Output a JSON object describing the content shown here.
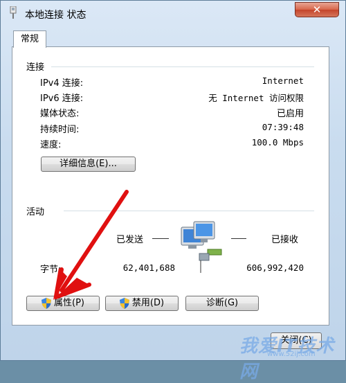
{
  "window": {
    "title": "本地连接 状态",
    "close_symbol": "✕"
  },
  "tabs": [
    {
      "label": "常规"
    }
  ],
  "connection": {
    "section_label": "连接",
    "rows": [
      {
        "label": "IPv4 连接:",
        "value": "Internet"
      },
      {
        "label": "IPv6 连接:",
        "value": "无 Internet 访问权限"
      },
      {
        "label": "媒体状态:",
        "value": "已启用"
      },
      {
        "label": "持续时间:",
        "value": "07:39:48"
      },
      {
        "label": "速度:",
        "value": "100.0 Mbps"
      }
    ],
    "details_button": "详细信息(E)..."
  },
  "activity": {
    "section_label": "活动",
    "sent_label": "已发送",
    "received_label": "已接收",
    "bytes_label": "字节:",
    "bytes_sent": "62,401,688",
    "bytes_received": "606,992,420"
  },
  "buttons": {
    "properties": "属性(P)",
    "disable": "禁用(D)",
    "diagnose": "诊断(G)",
    "close": "关闭(C)"
  },
  "watermark": {
    "text": "我爱IT技术网",
    "sub": "www.52ij.com"
  },
  "icons": {
    "title": "network-adapter-icon",
    "shield": "uac-shield-icon",
    "activity": "network-computers-icon"
  },
  "colors": {
    "annotation_arrow": "#e01010",
    "close_button": "#c4442b"
  }
}
